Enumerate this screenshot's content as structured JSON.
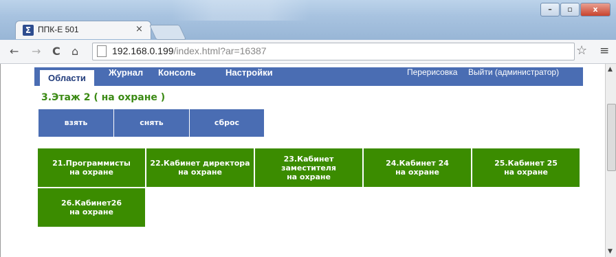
{
  "browser": {
    "tab_title": "ППК-Е 501",
    "tab_close": "×",
    "window_buttons": {
      "minimize": "–",
      "maximize": "▫",
      "close": "x"
    },
    "nav": {
      "back": "←",
      "forward": "→",
      "reload": "C",
      "home": "⌂"
    },
    "url_host": "192.168.0.199",
    "url_path": "/index.html?ar=16387",
    "star": "☆",
    "menu": "≡"
  },
  "app": {
    "tabs": [
      "Области",
      "Журнал",
      "Консоль",
      "Настройки"
    ],
    "links": {
      "redraw": "Перерисовка",
      "logout": "Выйти (администратор)"
    },
    "area_title": "3.Этаж 2 ( на охране )",
    "actions": [
      "взять",
      "снять",
      "сброс"
    ],
    "zones": [
      {
        "lines": [
          "21.Программисты",
          "на охране"
        ]
      },
      {
        "lines": [
          "22.Кабинет директора",
          "на охране"
        ]
      },
      {
        "lines": [
          "23.Кабинет",
          "заместителя",
          "на охране"
        ]
      },
      {
        "lines": [
          "24.Кабинет 24",
          "на охране"
        ]
      },
      {
        "lines": [
          "25.Кабинет 25",
          "на охране"
        ]
      },
      {
        "lines": [
          "26.Кабинет26",
          "на охране"
        ]
      }
    ]
  },
  "colors": {
    "nav_blue": "#4a6db3",
    "zone_green": "#3b8c00",
    "title_green": "#3b8a14"
  }
}
